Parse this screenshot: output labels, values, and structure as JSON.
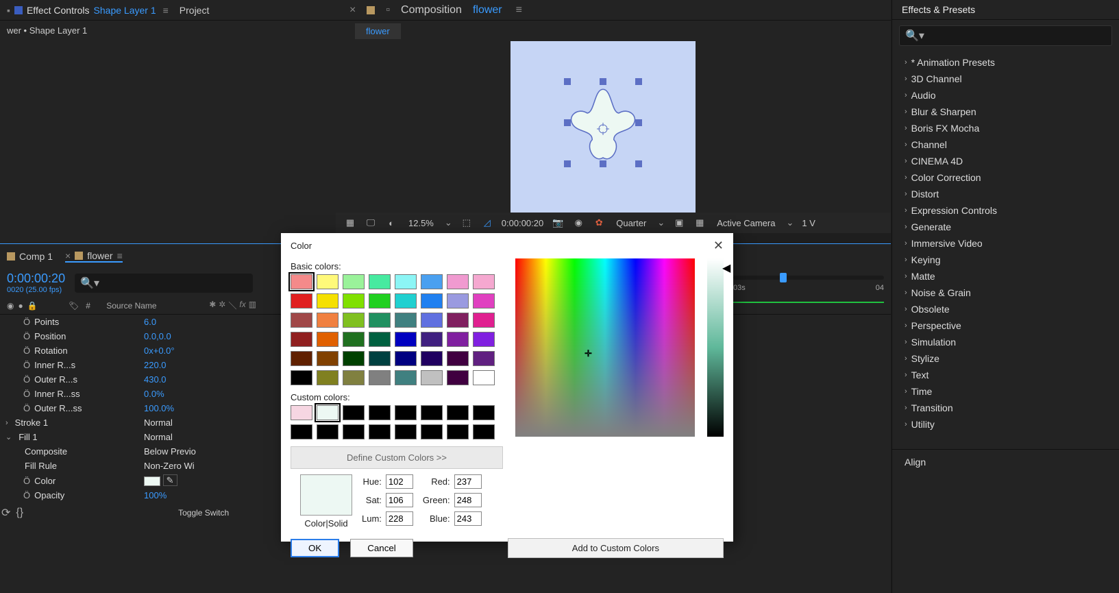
{
  "top_left_panel": {
    "tab1_prefix": "Effect Controls",
    "tab1_link": "Shape Layer 1",
    "tab2": "Project",
    "breadcrumb": "wer • Shape Layer 1"
  },
  "comp_panel": {
    "tab_prefix": "Composition",
    "tab_link": "flower",
    "active_tab": "flower",
    "zoom": "12.5%",
    "timecode": "0:00:00:20",
    "res": "Quarter",
    "camera": "Active Camera",
    "view_count": "1 V"
  },
  "effects_presets": {
    "title": "Effects & Presets",
    "categories": [
      "* Animation Presets",
      "3D Channel",
      "Audio",
      "Blur & Sharpen",
      "Boris FX Mocha",
      "Channel",
      "CINEMA 4D",
      "Color Correction",
      "Distort",
      "Expression Controls",
      "Generate",
      "Immersive Video",
      "Keying",
      "Matte",
      "Noise & Grain",
      "Obsolete",
      "Perspective",
      "Simulation",
      "Stylize",
      "Text",
      "Time",
      "Transition",
      "Utility"
    ],
    "align_title": "Align"
  },
  "timeline": {
    "tabs": {
      "tab1": "Comp 1",
      "tab2": "flower"
    },
    "time": "0:00:00:20",
    "fps": "0020 (25.00 fps)",
    "hash_col": "#",
    "source_col": "Source Name",
    "ruler_marks": [
      "03s",
      "04"
    ],
    "props": [
      {
        "name": "Points",
        "value": "6.0",
        "stopwatch": true
      },
      {
        "name": "Position",
        "value": "0.0,0.0",
        "stopwatch": true
      },
      {
        "name": "Rotation",
        "value": "0x+0.0°",
        "stopwatch": true
      },
      {
        "name": "Inner R...s",
        "value": "220.0",
        "stopwatch": true
      },
      {
        "name": "Outer R...s",
        "value": "430.0",
        "stopwatch": true
      },
      {
        "name": "Inner R...ss",
        "value": "0.0%",
        "stopwatch": true
      },
      {
        "name": "Outer R...ss",
        "value": "100.0%",
        "stopwatch": true
      }
    ],
    "groups": [
      {
        "name": "Stroke 1",
        "mode": "Normal",
        "expanded": false
      },
      {
        "name": "Fill 1",
        "mode": "Normal",
        "expanded": true
      }
    ],
    "fill_props": {
      "composite": {
        "label": "Composite",
        "value": "Below Previo"
      },
      "fill_rule": {
        "label": "Fill Rule",
        "value": "Non-Zero Wi"
      },
      "color": {
        "label": "Color"
      },
      "opacity": {
        "label": "Opacity",
        "value": "100%"
      }
    },
    "toggle": "Toggle Switch"
  },
  "color_dialog": {
    "title": "Color",
    "basic_label": "Basic colors:",
    "custom_label": "Custom colors:",
    "define_btn": "Define Custom Colors >>",
    "ok": "OK",
    "cancel": "Cancel",
    "add": "Add to Custom Colors",
    "color_solid": "Color|Solid",
    "basic_colors": [
      "#f48a8a",
      "#fff97a",
      "#9af29a",
      "#47eaa0",
      "#8cf5f5",
      "#4aa0f0",
      "#f09ad0",
      "#f5a8d0",
      "#e02020",
      "#f5e000",
      "#80e000",
      "#20d020",
      "#20d0d0",
      "#2080f0",
      "#9a9ae0",
      "#e040c0",
      "#a04848",
      "#f08040",
      "#80c020",
      "#209060",
      "#408080",
      "#6070e0",
      "#802060",
      "#e02090",
      "#902020",
      "#e06000",
      "#207020",
      "#006040",
      "#0000c0",
      "#402080",
      "#8020a0",
      "#8020e0",
      "#602000",
      "#804000",
      "#004000",
      "#004040",
      "#000080",
      "#200060",
      "#400040",
      "#602080",
      "#000000",
      "#808020",
      "#808040",
      "#808080",
      "#408080",
      "#c0c0c0",
      "#400040",
      "#ffffff"
    ],
    "custom_colors": [
      "#f6d6e2",
      "#edf8f3",
      "#000000",
      "#000000",
      "#000000",
      "#000000",
      "#000000",
      "#000000",
      "#000000",
      "#000000",
      "#000000",
      "#000000",
      "#000000",
      "#000000",
      "#000000",
      "#000000"
    ],
    "hue_label": "Hue:",
    "hue": "102",
    "sat_label": "Sat:",
    "sat": "106",
    "lum_label": "Lum:",
    "lum": "228",
    "red_label": "Red:",
    "red": "237",
    "green_label": "Green:",
    "green": "248",
    "blue_label": "Blue:",
    "blue": "243"
  }
}
